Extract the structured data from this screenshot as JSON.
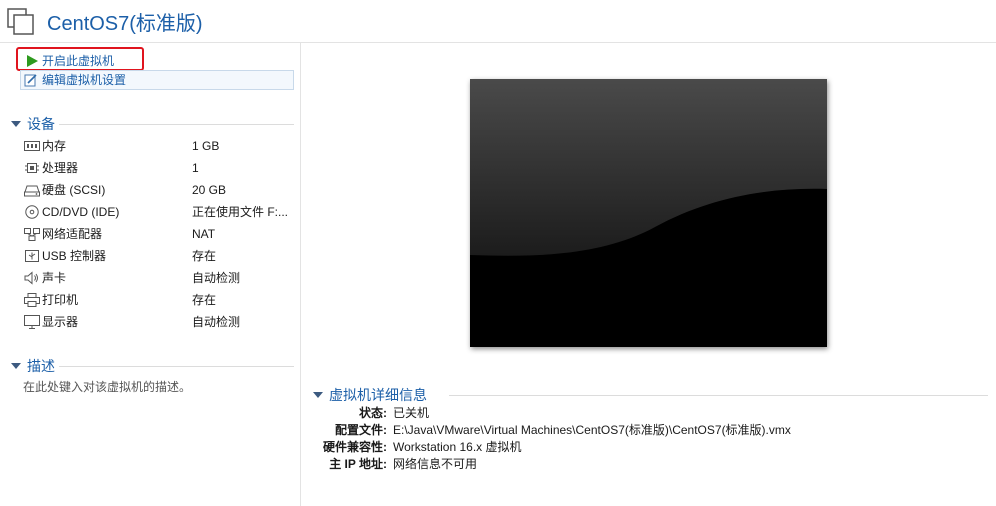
{
  "header": {
    "title": "CentOS7(标准版)"
  },
  "actions": {
    "start": "开启此虚拟机",
    "edit": "编辑虚拟机设置"
  },
  "devices": {
    "heading": "设备",
    "items": [
      {
        "icon": "memory-icon",
        "name": "内存",
        "value": "1 GB"
      },
      {
        "icon": "cpu-icon",
        "name": "处理器",
        "value": "1"
      },
      {
        "icon": "harddisk-icon",
        "name": "硬盘 (SCSI)",
        "value": "20 GB"
      },
      {
        "icon": "cd-dvd-icon",
        "name": "CD/DVD (IDE)",
        "value": "正在使用文件 F:..."
      },
      {
        "icon": "network-icon",
        "name": "网络适配器",
        "value": "NAT"
      },
      {
        "icon": "usb-icon",
        "name": "USB 控制器",
        "value": "存在"
      },
      {
        "icon": "sound-icon",
        "name": "声卡",
        "value": "自动检测"
      },
      {
        "icon": "printer-icon",
        "name": "打印机",
        "value": "存在"
      },
      {
        "icon": "display-icon",
        "name": "显示器",
        "value": "自动检测"
      }
    ]
  },
  "description": {
    "heading": "描述",
    "placeholder": "在此处键入对该虚拟机的描述。"
  },
  "details": {
    "heading": "虚拟机详细信息",
    "items": [
      {
        "key": "状态:",
        "value": "已关机"
      },
      {
        "key": "配置文件:",
        "value": "E:\\Java\\VMware\\Virtual Machines\\CentOS7(标准版)\\CentOS7(标准版).vmx"
      },
      {
        "key": "硬件兼容性:",
        "value": "Workstation 16.x 虚拟机"
      },
      {
        "key": "主 IP 地址:",
        "value": "网络信息不可用"
      }
    ]
  }
}
